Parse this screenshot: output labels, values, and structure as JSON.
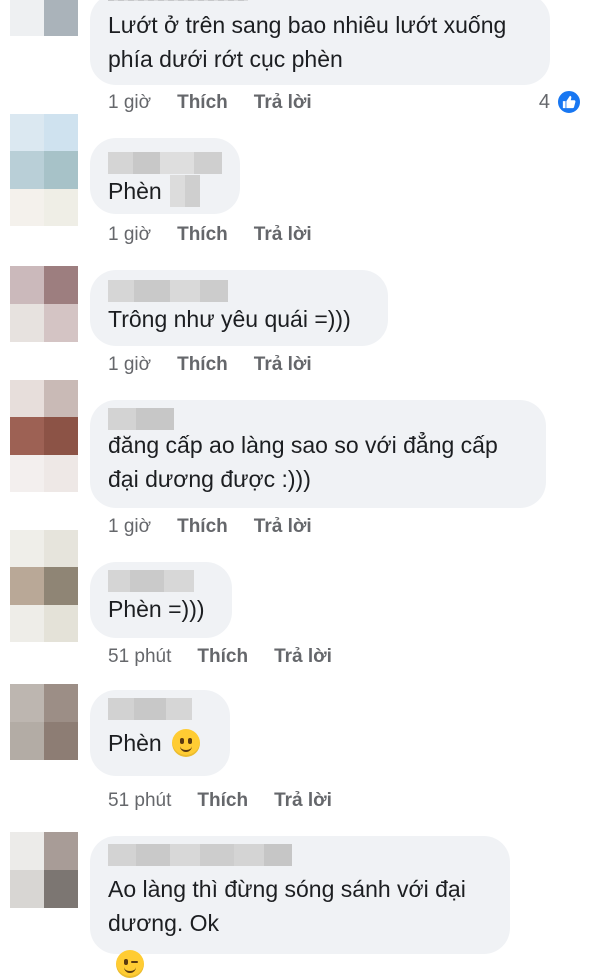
{
  "colors": {
    "bubble": "#f0f2f5",
    "meta": "#65676b",
    "like": "#1877f2"
  },
  "comments": [
    {
      "text": "Lướt ở trên sang bao nhiêu lướt xuống\nphía dưới rớt cục phèn",
      "time": "1 giờ",
      "like": "Thích",
      "reply": "Trả lời",
      "reaction_count": "4",
      "reaction_icon": "like-icon"
    },
    {
      "text": "Phèn",
      "time": "1 giờ",
      "like": "Thích",
      "reply": "Trả lời"
    },
    {
      "text": "Trông như yêu quái =)))",
      "time": "1 giờ",
      "like": "Thích",
      "reply": "Trả lời"
    },
    {
      "text": "đăng cấp ao làng sao so với đẳng cấp\nđại dương được :)))",
      "time": "1 giờ",
      "like": "Thích",
      "reply": "Trả lời"
    },
    {
      "text": "Phèn =)))",
      "time": "51 phút",
      "like": "Thích",
      "reply": "Trả lời"
    },
    {
      "text": "Phèn",
      "emoji": "slightly-smiling-face-icon",
      "time": "51 phút",
      "like": "Thích",
      "reply": "Trả lời"
    },
    {
      "text": "Ao làng thì đừng sóng sánh với đại\ndương. Ok",
      "emoji": "winking-face-icon"
    }
  ]
}
